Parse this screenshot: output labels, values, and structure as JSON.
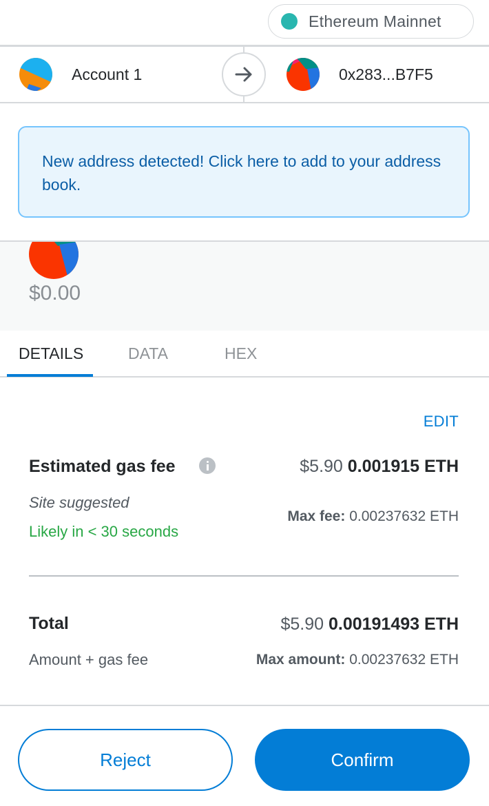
{
  "network": {
    "label": "Ethereum Mainnet",
    "dot_color": "#29b6af"
  },
  "sender": {
    "from_name": "Account 1",
    "to_address": "0x283...B7F5",
    "arrow_icon": "arrow-right-icon"
  },
  "banner": {
    "text": "New address detected! Click here to add to your address book."
  },
  "summary": {
    "amount": "$0.00"
  },
  "tabs": [
    {
      "label": "DETAILS",
      "active": true
    },
    {
      "label": "DATA",
      "active": false
    },
    {
      "label": "HEX",
      "active": false
    }
  ],
  "details": {
    "edit_label": "EDIT",
    "gas": {
      "label": "Estimated gas fee",
      "fiat": "$5.90",
      "eth": "0.001915 ETH",
      "source": "Site suggested",
      "timing": "Likely in < 30 seconds",
      "max_label": "Max fee:",
      "max_value": "0.00237632 ETH"
    },
    "total": {
      "label": "Total",
      "fiat": "$5.90",
      "eth": "0.00191493 ETH",
      "sublabel": "Amount + gas fee",
      "max_label": "Max amount:",
      "max_value": "0.00237632 ETH"
    }
  },
  "actions": {
    "reject_label": "Reject",
    "confirm_label": "Confirm"
  },
  "colors": {
    "primary": "#037dd6",
    "success": "#28a745",
    "banner_bg": "#e9f5fd",
    "banner_border": "#75c4fd"
  }
}
